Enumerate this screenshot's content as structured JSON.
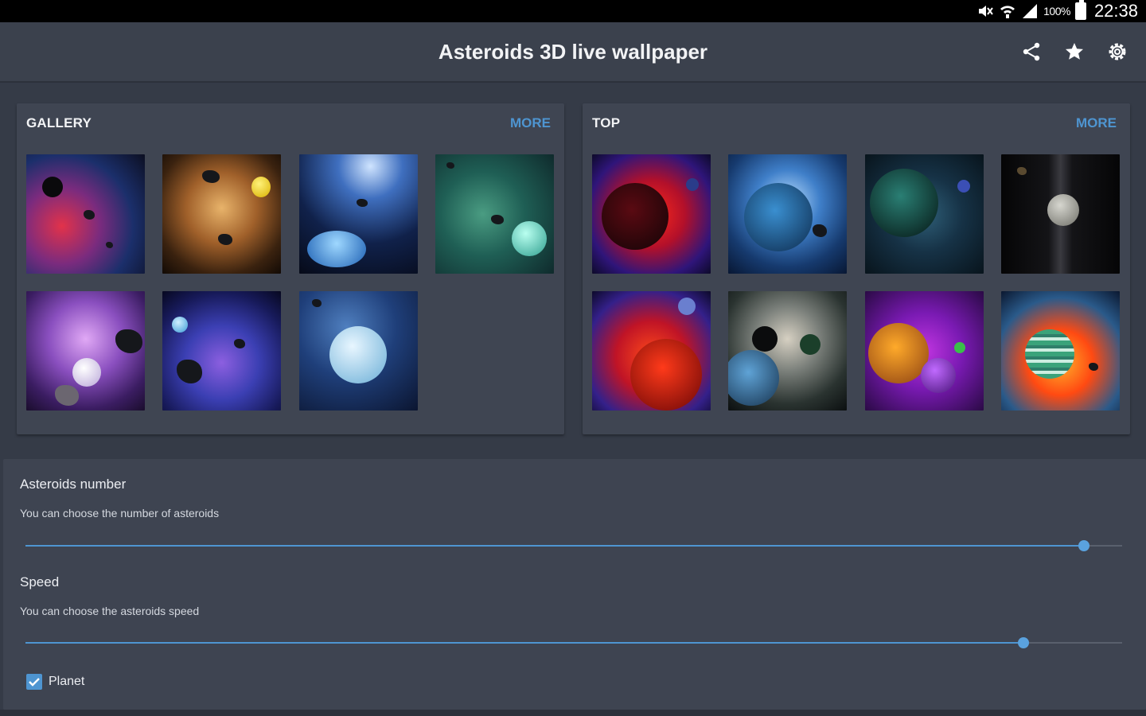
{
  "status_bar": {
    "battery_percent": "100%",
    "time": "22:38",
    "icons": [
      "mute-icon",
      "wifi-icon",
      "signal-icon",
      "battery-icon"
    ]
  },
  "app_bar": {
    "title": "Asteroids 3D live wallpaper",
    "actions": [
      "share-icon",
      "star-icon",
      "settings-icon"
    ]
  },
  "gallery": {
    "title": "GALLERY",
    "more_label": "MORE",
    "thumbnails": [
      {
        "theme": "red-blue nebula with dark planet"
      },
      {
        "theme": "golden nebula with yellow planet"
      },
      {
        "theme": "blue space with blue ringed planet"
      },
      {
        "theme": "teal nebula with cyan planet"
      },
      {
        "theme": "purple nebula with pale planet"
      },
      {
        "theme": "blue-purple starfield with blue planet"
      },
      {
        "theme": "blue space with ringed ice planet"
      }
    ]
  },
  "top": {
    "title": "TOP",
    "more_label": "MORE",
    "thumbnails": [
      {
        "theme": "red lava planet"
      },
      {
        "theme": "blue cracked planet"
      },
      {
        "theme": "dark teal webbed planet"
      },
      {
        "theme": "dark space with grey moon"
      },
      {
        "theme": "red nebula with red planet"
      },
      {
        "theme": "grey cloud with blue planet"
      },
      {
        "theme": "purple with orange planet"
      },
      {
        "theme": "fiery nebula with striped planet"
      }
    ]
  },
  "settings": {
    "asteroids_number": {
      "title": "Asteroids number",
      "summary": "You can choose the number of asteroids",
      "value_fraction": 0.965
    },
    "speed": {
      "title": "Speed",
      "summary": "You can choose the asteroids speed",
      "value_fraction": 0.91
    },
    "planet": {
      "label": "Planet",
      "checked": true
    }
  },
  "colors": {
    "accent": "#4e95d1",
    "background": "#353b47",
    "card": "#3f4552"
  }
}
